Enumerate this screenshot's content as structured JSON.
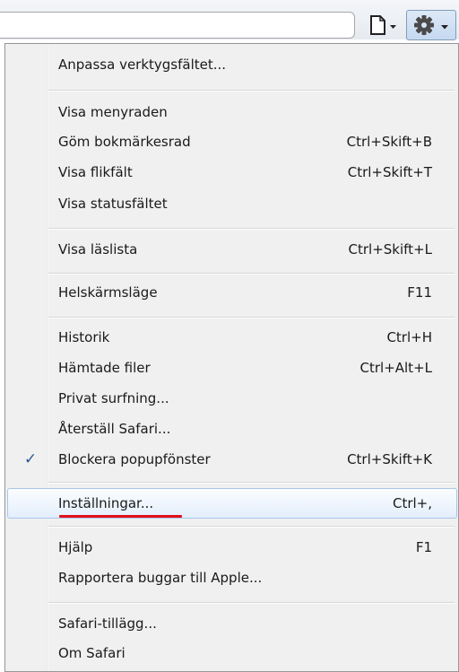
{
  "toolbar": {
    "address_value": "",
    "page_icon": "page-icon",
    "settings_icon": "gear-icon",
    "colors": {
      "gear_button_bg": "#c6d9f0",
      "gear_button_border": "#7f9db9"
    }
  },
  "menu": {
    "colors": {
      "background": "#f0f0f0",
      "hover_border": "#a9c6ea",
      "underline": "#e0101a",
      "check": "#2b5797"
    },
    "items": [
      {
        "label": "Anpassa verktygsfältet...",
        "shortcut": ""
      },
      {
        "label": "Visa menyraden",
        "shortcut": ""
      },
      {
        "label": "Göm bokmärkesrad",
        "shortcut": "Ctrl+Skift+B"
      },
      {
        "label": "Visa flikfält",
        "shortcut": "Ctrl+Skift+T"
      },
      {
        "label": "Visa statusfältet",
        "shortcut": ""
      },
      {
        "label": "Visa läslista",
        "shortcut": "Ctrl+Skift+L"
      },
      {
        "label": "Helskärmsläge",
        "shortcut": "F11"
      },
      {
        "label": "Historik",
        "shortcut": "Ctrl+H"
      },
      {
        "label": "Hämtade filer",
        "shortcut": "Ctrl+Alt+L"
      },
      {
        "label": "Privat surfning...",
        "shortcut": ""
      },
      {
        "label": "Återställ Safari...",
        "shortcut": ""
      },
      {
        "label": "Blockera popupfönster",
        "shortcut": "Ctrl+Skift+K",
        "checked": true,
        "check_mark": "✓"
      },
      {
        "label": "Inställningar...",
        "shortcut": "Ctrl+,",
        "highlighted": true
      },
      {
        "label": "Hjälp",
        "shortcut": "F1"
      },
      {
        "label": "Rapportera buggar till Apple...",
        "shortcut": ""
      },
      {
        "label": "Safari-tillägg...",
        "shortcut": ""
      },
      {
        "label": "Om Safari",
        "shortcut": ""
      }
    ]
  }
}
